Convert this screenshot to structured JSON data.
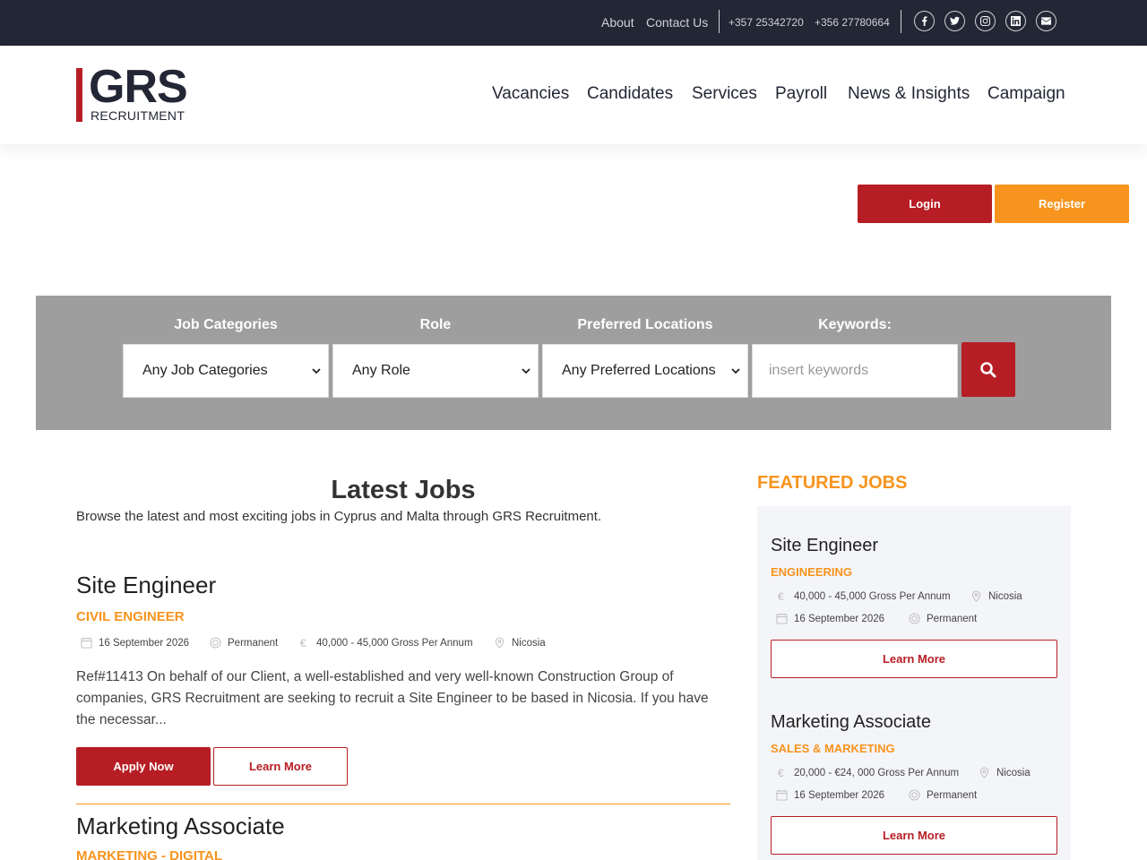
{
  "topbar": {
    "about": "About",
    "contact": "Contact Us",
    "phone1": "+357 25342720",
    "phone2": "+356 27780664",
    "social": [
      "facebook-icon",
      "twitter-icon",
      "instagram-icon",
      "linkedin-icon",
      "envelope-icon"
    ]
  },
  "header": {
    "logo_main": "GRS",
    "logo_sub": "RECRUITMENT",
    "nav": [
      "Vacancies",
      "Candidates",
      "Services",
      "Payroll",
      "News & Insights",
      "Campaign"
    ]
  },
  "auth": {
    "login": "Login",
    "register": "Register"
  },
  "search": {
    "labels": [
      "Job Categories",
      "Role",
      "Preferred Locations",
      "Keywords:"
    ],
    "selects": [
      "Any Job Categories",
      "Any Role",
      "Any Preferred Locations"
    ],
    "keywords_placeholder": "insert keywords"
  },
  "latest": {
    "title": "Latest Jobs",
    "description": "Browse the latest and most exciting jobs in Cyprus and Malta through GRS Recruitment.",
    "jobs": [
      {
        "title": "Site Engineer",
        "category": "CIVIL ENGINEER",
        "date": "16 September 2026",
        "type": "Permanent",
        "salary": "40,000 - 45,000 Gross Per Annum",
        "location": "Nicosia",
        "description": "Ref#11413 On behalf of our Client, a well-established and very well-known Construction Group of companies, GRS Recruitment are seeking to recruit a Site Engineer to be based in Nicosia. If you have the necessar...",
        "apply": "Apply Now",
        "learn": "Learn More"
      },
      {
        "title": "Marketing Associate",
        "category": "MARKETING - DIGITAL"
      }
    ]
  },
  "featured": {
    "heading": "FEATURED JOBS",
    "jobs": [
      {
        "title": "Site Engineer",
        "category": "ENGINEERING",
        "salary": "40,000 - 45,000 Gross Per Annum",
        "location": "Nicosia",
        "date": "16  September  2026",
        "type": "Permanent",
        "learn": "Learn More"
      },
      {
        "title": "Marketing Associate",
        "category": "SALES & MARKETING",
        "salary": "20,000 - €24, 000 Gross Per Annum",
        "location": "Nicosia",
        "date": "16  September  2026",
        "type": "Permanent",
        "learn": "Learn More"
      }
    ]
  },
  "colors": {
    "brand_red": "#b71d24",
    "brand_orange": "#f7941d",
    "dark": "#232634",
    "panel_gray": "#9e9e9e"
  }
}
